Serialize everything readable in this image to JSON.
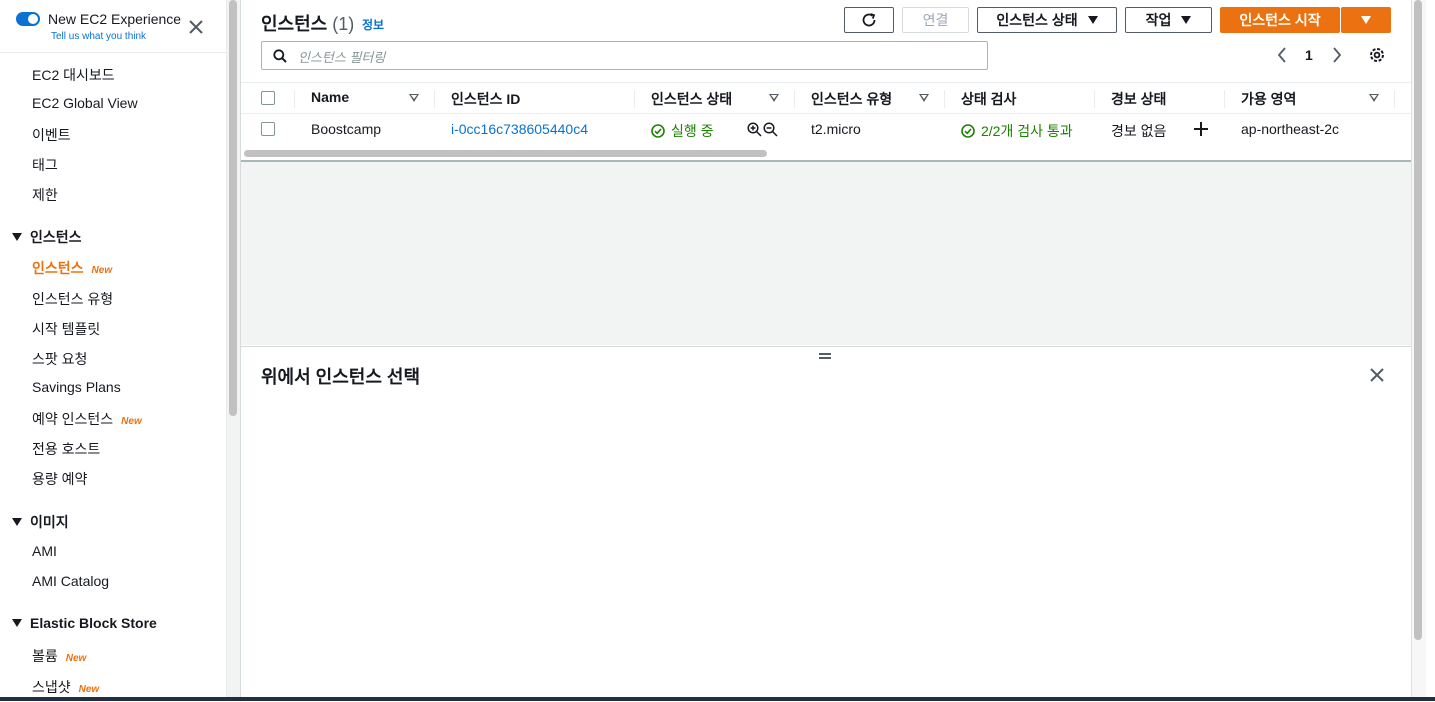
{
  "colors": {
    "accent": "#ec7211",
    "link": "#0972d3",
    "ok": "#1d8102"
  },
  "sidebar": {
    "experience_title": "New EC2 Experience",
    "experience_link": "Tell us what you think",
    "items_top": [
      "EC2 대시보드",
      "EC2 Global View",
      "이벤트",
      "태그",
      "제한"
    ],
    "sections": {
      "instances": "인스턴스",
      "images": "이미지",
      "ebs": "Elastic Block Store"
    },
    "instances_items": [
      "인스턴스",
      "인스턴스 유형",
      "시작 템플릿",
      "스팟 요청",
      "Savings Plans",
      "예약 인스턴스",
      "전용 호스트",
      "용량 예약"
    ],
    "images_items": [
      "AMI",
      "AMI Catalog"
    ],
    "ebs_items": [
      "볼륨",
      "스냅샷"
    ],
    "new_badge": "New"
  },
  "header": {
    "title": "인스턴스",
    "count": "(1)",
    "info": "정보",
    "buttons": {
      "connect": "연결",
      "instance_state": "인스턴스 상태",
      "actions": "작업",
      "launch": "인스턴스 시작"
    },
    "filter_placeholder": "인스턴스 필터링",
    "page": "1"
  },
  "table": {
    "columns": [
      "Name",
      "인스턴스 ID",
      "인스턴스 상태",
      "인스턴스 유형",
      "상태 검사",
      "경보 상태",
      "가용 영역"
    ],
    "rows": [
      {
        "name": "Boostcamp",
        "instance_id": "i-0cc16c738605440c4",
        "state": "실행 중",
        "type": "t2.micro",
        "status_check": "2/2개 검사 통과",
        "alarm": "경보 없음",
        "az": "ap-northeast-2c"
      }
    ]
  },
  "detail": {
    "title": "위에서 인스턴스 선택"
  }
}
